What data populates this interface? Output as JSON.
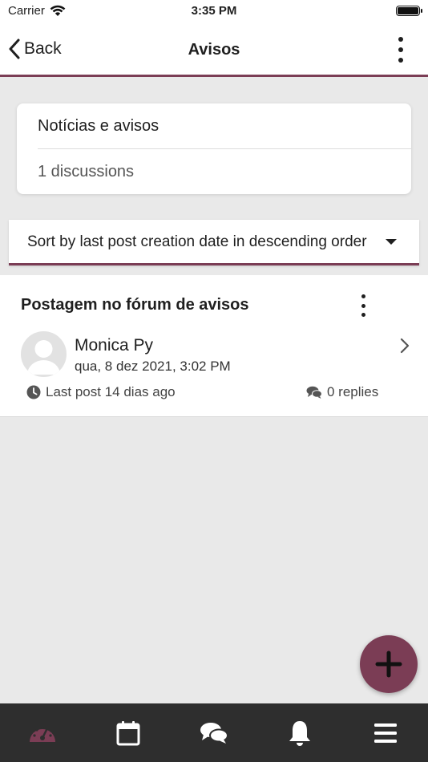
{
  "status_bar": {
    "carrier": "Carrier",
    "time": "3:35 PM"
  },
  "nav": {
    "back_label": "Back",
    "title": "Avisos"
  },
  "forum": {
    "name": "Notícias e avisos",
    "count": "1 discussions"
  },
  "sort": {
    "selected": "Sort by last post creation date in descending order"
  },
  "discussion": {
    "subject": "Postagem no fórum de avisos",
    "author": "Monica Py",
    "date": "qua, 8 dez 2021, 3:02 PM",
    "last_post": "Last post 14 dias ago",
    "replies": "0 replies"
  },
  "tabs": [
    {
      "icon": "dashboard-icon",
      "active": true
    },
    {
      "icon": "calendar-icon",
      "active": false
    },
    {
      "icon": "messages-icon",
      "active": false
    },
    {
      "icon": "notifications-icon",
      "active": false
    },
    {
      "icon": "menu-icon",
      "active": false
    }
  ],
  "colors": {
    "accent": "#7b3d55",
    "tab_bar": "#2e2e2e",
    "background": "#e9e9e9"
  }
}
